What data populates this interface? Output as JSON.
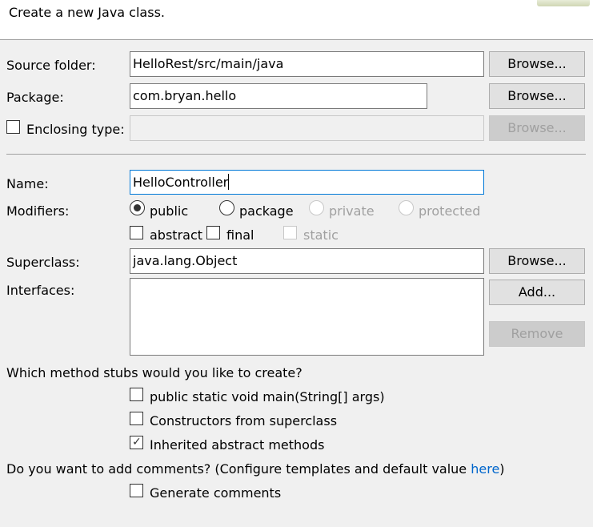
{
  "header": {
    "description": "Create a new Java class."
  },
  "form": {
    "source_folder": {
      "label": "Source folder:",
      "value": "HelloRest/src/main/java",
      "browse": "Browse..."
    },
    "package": {
      "label": "Package:",
      "value": "com.bryan.hello",
      "browse": "Browse..."
    },
    "enclosing_type": {
      "label": "Enclosing type:",
      "value": "",
      "browse": "Browse...",
      "checked": false
    },
    "name": {
      "label": "Name:",
      "value": "HelloController"
    },
    "modifiers": {
      "label": "Modifiers:",
      "public": "public",
      "package": "package",
      "private": "private",
      "protected": "protected",
      "abstract": "abstract",
      "final": "final",
      "static": "static",
      "selected": "public"
    },
    "superclass": {
      "label": "Superclass:",
      "value": "java.lang.Object",
      "browse": "Browse..."
    },
    "interfaces": {
      "label": "Interfaces:",
      "add": "Add...",
      "remove": "Remove"
    },
    "stubs": {
      "question": "Which method stubs would you like to create?",
      "main": "public static void main(String[] args)",
      "constructors": "Constructors from superclass",
      "inherited": "Inherited abstract methods"
    },
    "comments": {
      "question_prefix": "Do you want to add comments? (Configure templates and default value ",
      "link": "here",
      "question_suffix": ")",
      "generate": "Generate comments"
    }
  },
  "colors": {
    "link": "#0066cc",
    "focus_border": "#0078d7",
    "background": "#f0f0f0"
  },
  "icons": {
    "checkmark": "check-icon",
    "radio_selected": "radio-dot-icon"
  }
}
